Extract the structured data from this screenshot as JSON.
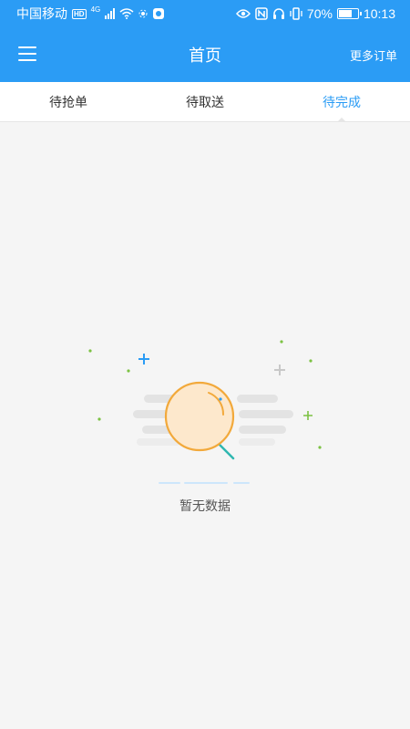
{
  "status_bar": {
    "carrier": "中国移动",
    "hd_badge": "HD",
    "network": "4G",
    "battery_percent": "70%",
    "battery_level": 0.7,
    "time": "10:13"
  },
  "header": {
    "title": "首页",
    "more_orders": "更多订单",
    "menu_icon": "hamburger-menu-icon"
  },
  "tabs": [
    {
      "label": "待抢单",
      "active": false
    },
    {
      "label": "待取送",
      "active": false
    },
    {
      "label": "待完成",
      "active": true
    }
  ],
  "empty_state": {
    "text": "暂无数据",
    "icon": "magnifier-empty-icon"
  },
  "colors": {
    "primary": "#2b9cf5",
    "background": "#f5f5f5",
    "accent_orange": "#f2a93b",
    "accent_green": "#7cc243"
  }
}
